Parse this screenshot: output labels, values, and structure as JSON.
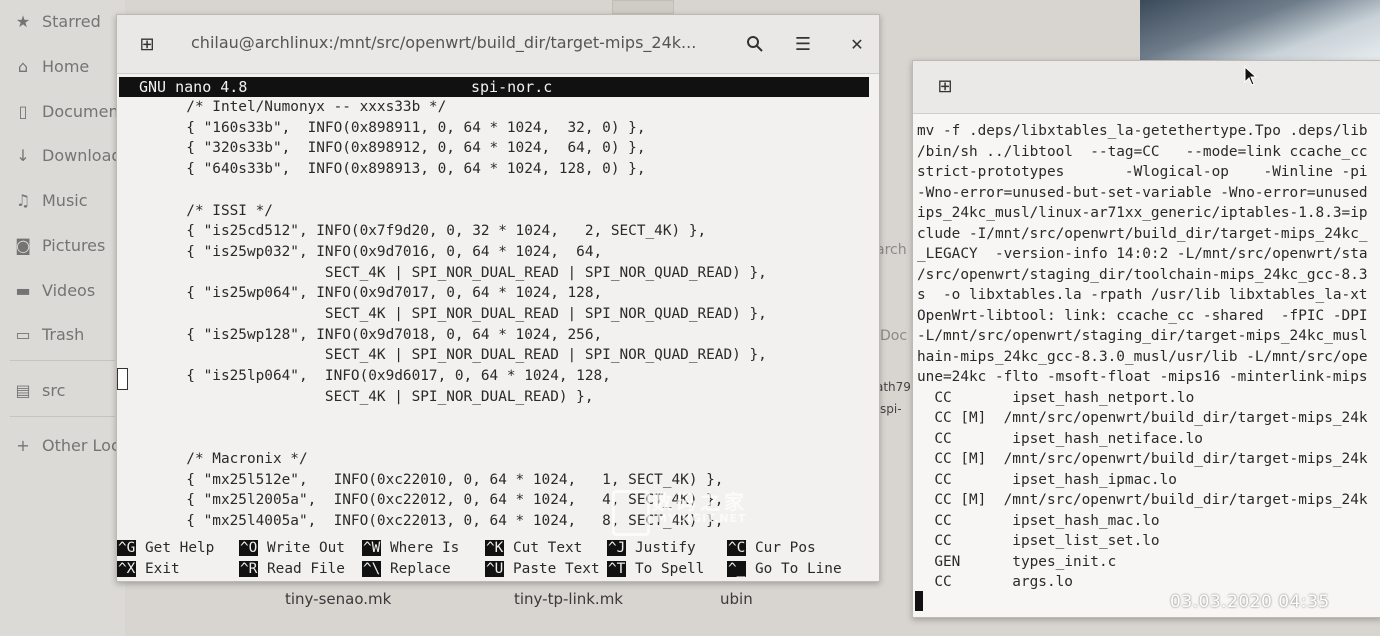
{
  "sidebar": {
    "items": [
      {
        "label": "Starred",
        "icon": "star-icon"
      },
      {
        "label": "Home",
        "icon": "home-icon"
      },
      {
        "label": "Documen",
        "icon": "document-icon"
      },
      {
        "label": "Download",
        "icon": "download-icon"
      },
      {
        "label": "Music",
        "icon": "music-icon"
      },
      {
        "label": "Pictures",
        "icon": "camera-icon"
      },
      {
        "label": "Videos",
        "icon": "video-icon"
      },
      {
        "label": "Trash",
        "icon": "trash-icon"
      },
      {
        "label": "src",
        "icon": "drive-icon"
      },
      {
        "label": "Other Loc",
        "icon": "plus-icon"
      }
    ]
  },
  "background_files": [
    "tiny-senao.mk",
    "tiny-tp-link.mk",
    "ubin"
  ],
  "background_fragments": [
    "arch",
    "Doc",
    "ath79",
    "/spi-"
  ],
  "main_terminal": {
    "title": "chilau@archlinux:/mnt/src/openwrt/build_dir/target-mips_24k...",
    "nano_version": "GNU nano 4.8",
    "filename": "spi-nor.c",
    "code_lines": [
      "        /* Intel/Numonyx -- xxxs33b */",
      "        { \"160s33b\",  INFO(0x898911, 0, 64 * 1024,  32, 0) },",
      "        { \"320s33b\",  INFO(0x898912, 0, 64 * 1024,  64, 0) },",
      "        { \"640s33b\",  INFO(0x898913, 0, 64 * 1024, 128, 0) },",
      "",
      "        /* ISSI */",
      "        { \"is25cd512\", INFO(0x7f9d20, 0, 32 * 1024,   2, SECT_4K) },",
      "        { \"is25wp032\", INFO(0x9d7016, 0, 64 * 1024,  64,",
      "                        SECT_4K | SPI_NOR_DUAL_READ | SPI_NOR_QUAD_READ) },",
      "        { \"is25wp064\", INFO(0x9d7017, 0, 64 * 1024, 128,",
      "                        SECT_4K | SPI_NOR_DUAL_READ | SPI_NOR_QUAD_READ) },",
      "        { \"is25wp128\", INFO(0x9d7018, 0, 64 * 1024, 256,",
      "                        SECT_4K | SPI_NOR_DUAL_READ | SPI_NOR_QUAD_READ) },",
      "        { \"is25lp064\",  INFO(0x9d6017, 0, 64 * 1024, 128,",
      "                        SECT_4K | SPI_NOR_DUAL_READ) },",
      "",
      "",
      "        /* Macronix */",
      "        { \"mx25l512e\",   INFO(0xc22010, 0, 64 * 1024,   1, SECT_4K) },",
      "        { \"mx25l2005a\",  INFO(0xc22012, 0, 64 * 1024,   4, SECT_4K) },",
      "        { \"mx25l4005a\",  INFO(0xc22013, 0, 64 * 1024,   8, SECT_4K) },"
    ],
    "shortcuts": [
      {
        "key": "^G",
        "label": "Get Help"
      },
      {
        "key": "^O",
        "label": "Write Out"
      },
      {
        "key": "^W",
        "label": "Where Is"
      },
      {
        "key": "^K",
        "label": "Cut Text"
      },
      {
        "key": "^J",
        "label": "Justify"
      },
      {
        "key": "^C",
        "label": "Cur Pos"
      },
      {
        "key": "^X",
        "label": "Exit"
      },
      {
        "key": "^R",
        "label": "Read File"
      },
      {
        "key": "^\\",
        "label": "Replace"
      },
      {
        "key": "^U",
        "label": "Paste Text"
      },
      {
        "key": "^T",
        "label": "To Spell"
      },
      {
        "key": "^_",
        "label": "Go To Line"
      }
    ]
  },
  "side_terminal": {
    "log_lines": [
      "mv -f .deps/libxtables_la-getethertype.Tpo .deps/lib",
      "/bin/sh ../libtool  --tag=CC   --mode=link ccache_cc",
      "strict-prototypes       -Wlogical-op    -Winline -pi",
      "-Wno-error=unused-but-set-variable -Wno-error=unused",
      "ips_24kc_musl/linux-ar71xx_generic/iptables-1.8.3=ip",
      "clude -I/mnt/src/openwrt/build_dir/target-mips_24kc_",
      "_LEGACY  -version-info 14:0:2 -L/mnt/src/openwrt/sta",
      "/src/openwrt/staging_dir/toolchain-mips_24kc_gcc-8.3",
      "s  -o libxtables.la -rpath /usr/lib libxtables_la-xt",
      "OpenWrt-libtool: link: ccache_cc -shared  -fPIC -DPI",
      "-L/mnt/src/openwrt/staging_dir/target-mips_24kc_musl",
      "hain-mips_24kc_gcc-8.3.0_musl/usr/lib -L/mnt/src/ope",
      "une=24kc -flto -msoft-float -mips16 -minterlink-mips",
      "  CC       ipset_hash_netport.lo",
      "  CC [M]  /mnt/src/openwrt/build_dir/target-mips_24k",
      "  CC       ipset_hash_netiface.lo",
      "  CC [M]  /mnt/src/openwrt/build_dir/target-mips_24k",
      "  CC       ipset_hash_ipmac.lo",
      "  CC [M]  /mnt/src/openwrt/build_dir/target-mips_24k",
      "  CC       ipset_hash_mac.lo",
      "  CC       ipset_list_set.lo",
      "  GEN      types_init.c",
      "  CC       args.lo"
    ]
  },
  "watermark": {
    "text": "数码之家",
    "sub": "MYDIGIT.NET"
  },
  "timestamp": "03.03.2020  04:35"
}
